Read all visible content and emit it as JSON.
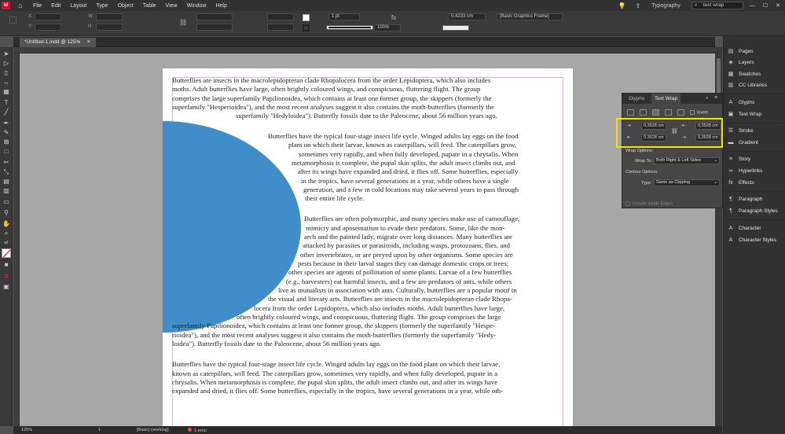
{
  "menubar": {
    "logo": "Id",
    "items": [
      "File",
      "Edit",
      "Layout",
      "Type",
      "Object",
      "Table",
      "View",
      "Window",
      "Help"
    ],
    "workspace": "Typography",
    "search_value": "text wrap"
  },
  "control": {
    "stroke_weight": "1 pt",
    "zoom_percent": "100%",
    "offset_value": "0,4233 cm",
    "object_style": "[Basic Graphics Frame]"
  },
  "document": {
    "tab_title": "*Untitled-1.indd @ 125%",
    "tab_close": "✕"
  },
  "text_lines": [
    {
      "text": "Butterflies are insects in the macrolepidopteran clade Rhopalocera from the order Lepidoptera, which also includes"
    },
    {
      "text": "moths. Adult butterflies have large, often brightly coloured wings, and conspicuous, fluttering flight. The group"
    },
    {
      "text": "comprises the large superfamily Papilionoidea, which contains at least one former group, the skippers (formerly the"
    },
    {
      "text": "superfamily \"Hesperioidea\"), and the most recent analyses suggest it also contains the moth-butterflies (formerly the"
    },
    {
      "text": "superfamily \"Hedyloidea\"). Butterfly fossils date to the Paleocene, about 56 million years ago."
    },
    {
      "text": "Butterflies have the typical four-stage insect life cycle. Winged adults lay eggs on the food"
    },
    {
      "text": "plant on which their larvae, known as caterpillars, will feed. The caterpillars grow,"
    },
    {
      "text": "sometimes very rapidly, and when fully developed, pupate in a chrysalis. When"
    },
    {
      "text": "metamorphosis is complete, the pupal skin splits, the adult insect climbs out, and"
    },
    {
      "text": "after its wings have expanded and dried, it flies off. Some butterflies, especially"
    },
    {
      "text": "in the tropics, have several generations in a year, while others have a single"
    },
    {
      "text": "generation, and a few in cold locations may take several years to pass through"
    },
    {
      "text": "their entire life cycle."
    },
    {
      "text": "Butterflies are often polymorphic, and many species make use of camouflage,"
    },
    {
      "text": "mimicry and aposematism to evade their predators. Some, like the mon-"
    },
    {
      "text": "arch and the painted lady, migrate over long distances. Many butterflies are"
    },
    {
      "text": "attacked by parasites or parasitoids, including wasps, protozoans, flies, and"
    },
    {
      "text": "other invertebrates, or are preyed upon by other organisms. Some species are"
    },
    {
      "text": "pests because in their larval stages they can damage domestic crops or trees;"
    },
    {
      "text": "other species are agents of pollination of some plants. Larvae of a few butterflies"
    },
    {
      "text": "(e.g., harvesters) eat harmful insects, and a few are predators of ants, while others"
    },
    {
      "text": "live as mutualists in association with ants. Culturally, butterflies are a popular motif in"
    },
    {
      "text": "the visual and literary arts. Butterflies are insects in the macrolepidopteran clade Rhopa-"
    },
    {
      "text": "locera from the order Lepidoptera, which also includes moths. Adult butterflies have large,"
    },
    {
      "text": "often brightly coloured wings, and conspicuous, fluttering flight. The group comprises the large"
    },
    {
      "text": "superfamily Papilionoidea, which contains at least one former group, the skippers (formerly the superfamily \"Hespe-"
    },
    {
      "text": "rioidea\"), and the most recent analyses suggest it also contains the moth-butterflies (formerly the superfamily \"Hedy-"
    },
    {
      "text": "loidea\"). Butterfly fossils date to the Paleocene, about 56 million years ago."
    },
    {
      "text": "Butterflies have the typical four-stage insect life cycle. Winged adults lay eggs on the food plant on which their larvae,"
    },
    {
      "text": "known as caterpillars, will feed. The caterpillars grow, sometimes very rapidly, and when fully developed, pupate in a"
    },
    {
      "text": "chrysalis. When metamorphosis is complete, the pupal skin splits, the adult insect climbs out, and after its wings have"
    },
    {
      "text": "expanded and dried, it flies off. Some butterflies, especially in the tropics, have several generations in a year, while oth-"
    }
  ],
  "text_wrap_panel": {
    "tab_glyphs": "Glyphs",
    "tab_text_wrap": "Text Wrap",
    "invert_label": "Invert",
    "top_offset": "0,3528 cm",
    "bottom_offset": "0,3528 cm",
    "left_offset": "0,3528 cm",
    "right_offset": "0,3528 cm",
    "wrap_options_label": "Wrap Options:",
    "wrap_to_label": "Wrap To:",
    "wrap_to_value": "Both Right & Left Sides",
    "contour_options_label": "Contour Options:",
    "type_label": "Type:",
    "type_value": "Same as Clipping",
    "include_inside_edges": "Include Inside Edges"
  },
  "dock": {
    "items": [
      {
        "label": "Pages",
        "icon": "pages-icon"
      },
      {
        "label": "Layers",
        "icon": "layers-icon"
      },
      {
        "label": "Swatches",
        "icon": "swatches-icon"
      },
      {
        "label": "CC Libraries",
        "icon": "cc-libraries-icon"
      },
      {
        "label": "Glyphs",
        "icon": "glyphs-icon"
      },
      {
        "label": "Text Wrap",
        "icon": "text-wrap-icon"
      },
      {
        "label": "Stroke",
        "icon": "stroke-icon"
      },
      {
        "label": "Gradient",
        "icon": "gradient-icon"
      },
      {
        "label": "Story",
        "icon": "story-icon"
      },
      {
        "label": "Hyperlinks",
        "icon": "hyperlinks-icon"
      },
      {
        "label": "Effects",
        "icon": "effects-icon"
      },
      {
        "label": "Paragraph",
        "icon": "paragraph-icon"
      },
      {
        "label": "Paragraph Styles",
        "icon": "paragraph-styles-icon"
      },
      {
        "label": "Character",
        "icon": "character-icon"
      },
      {
        "label": "Character Styles",
        "icon": "character-styles-icon"
      }
    ]
  },
  "status": {
    "zoom": "125%",
    "page": "1",
    "preflight_profile": "[Basic] (working)",
    "errors": "1 error"
  },
  "colors": {
    "circle_fill": "#3f8ec9",
    "highlight": "#f2e600",
    "error_dot": "#e34850"
  }
}
